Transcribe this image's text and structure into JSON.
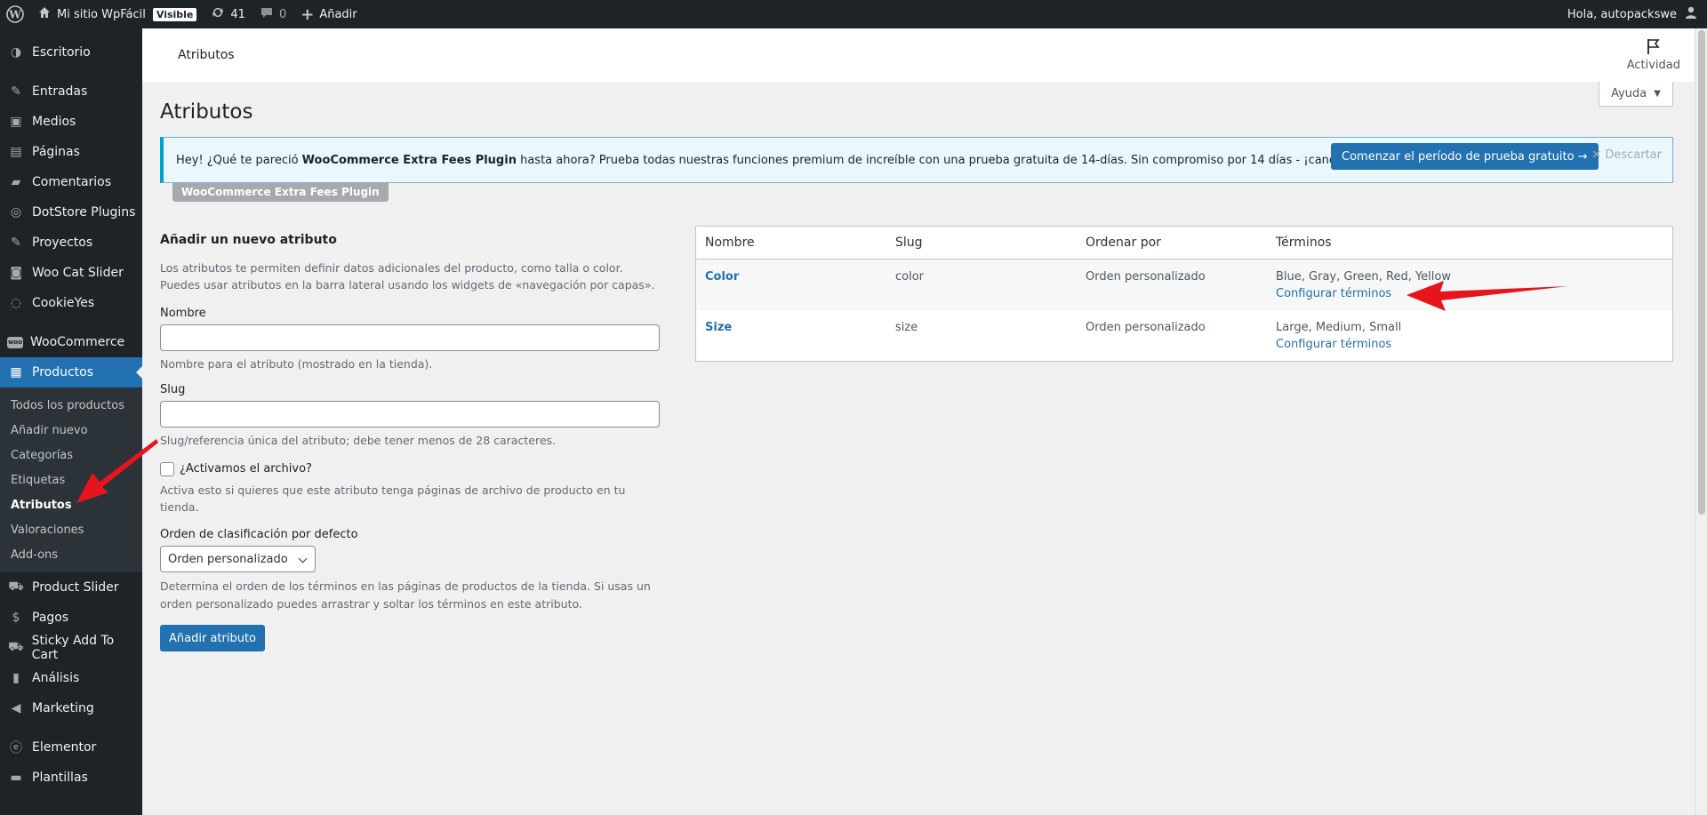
{
  "adminbar": {
    "site_name": "Mi sitio WpFácil",
    "visible_badge": "Visible",
    "updates_count": "41",
    "comments_count": "0",
    "add_new": "Añadir",
    "greeting": "Hola, autopackswe"
  },
  "sidebar": {
    "items": [
      {
        "label": "Escritorio",
        "icon": "dashboard-icon"
      },
      {
        "label": "Entradas",
        "icon": "pin-icon"
      },
      {
        "label": "Medios",
        "icon": "media-icon"
      },
      {
        "label": "Páginas",
        "icon": "page-icon"
      },
      {
        "label": "Comentarios",
        "icon": "comment-icon"
      },
      {
        "label": "DotStore Plugins",
        "icon": "dotstore-icon"
      },
      {
        "label": "Proyectos",
        "icon": "pin-icon"
      },
      {
        "label": "Woo Cat Slider",
        "icon": "camera-icon"
      },
      {
        "label": "CookieYes",
        "icon": "cookie-icon"
      },
      {
        "label": "WooCommerce",
        "icon": "woocommerce-icon"
      },
      {
        "label": "Productos",
        "icon": "archive-icon"
      },
      {
        "label": "Product Slider",
        "icon": "cart-icon"
      },
      {
        "label": "Pagos",
        "icon": "money-icon"
      },
      {
        "label": "Sticky Add To Cart",
        "icon": "cart-icon"
      },
      {
        "label": "Análisis",
        "icon": "chart-icon"
      },
      {
        "label": "Marketing",
        "icon": "megaphone-icon"
      },
      {
        "label": "Elementor",
        "icon": "elementor-icon"
      },
      {
        "label": "Plantillas",
        "icon": "folder-icon"
      }
    ],
    "submenu": [
      "Todos los productos",
      "Añadir nuevo",
      "Categorías",
      "Etiquetas",
      "Atributos",
      "Valoraciones",
      "Add-ons"
    ]
  },
  "topbar": {
    "breadcrumb": "Atributos",
    "activity": "Actividad"
  },
  "help": "Ayuda",
  "page_title": "Atributos",
  "notice": {
    "text_pre": "Hey! ¿Qué te pareció ",
    "plugin_name": "WooCommerce Extra Fees Plugin",
    "text_post": " hasta ahora? Prueba todas nuestras funciones premium de increíble con una prueba gratuita de 14-días. Sin compromiso por 14 días - ¡cancelar en cualquier momento!",
    "cta": "Comenzar el período de prueba gratuito →",
    "dismiss": "Descartar",
    "tag": "WooCommerce Extra Fees Plugin"
  },
  "form": {
    "heading": "Añadir un nuevo atributo",
    "intro": "Los atributos te permiten definir datos adicionales del producto, como talla o color. Puedes usar atributos en la barra lateral usando los widgets de «navegación por capas».",
    "name_label": "Nombre",
    "name_value": "",
    "name_help": "Nombre para el atributo (mostrado en la tienda).",
    "slug_label": "Slug",
    "slug_value": "",
    "slug_help": "Slug/referencia única del atributo; debe tener menos de 28 caracteres.",
    "archive_label": "¿Activamos el archivo?",
    "archive_help": "Activa esto si quieres que este atributo tenga páginas de archivo de producto en tu tienda.",
    "order_label": "Orden de clasificación por defecto",
    "order_value": "Orden personalizado",
    "order_help": "Determina el orden de los términos en las páginas de productos de la tienda. Si usas un orden personalizado puedes arrastrar y soltar los términos en este atributo.",
    "submit": "Añadir atributo"
  },
  "table": {
    "headers": [
      "Nombre",
      "Slug",
      "Ordenar por",
      "Términos"
    ],
    "rows": [
      {
        "name": "Color",
        "slug": "color",
        "order": "Orden personalizado",
        "terms": "Blue, Gray, Green, Red, Yellow",
        "configure": "Configurar términos"
      },
      {
        "name": "Size",
        "slug": "size",
        "order": "Orden personalizado",
        "terms": "Large, Medium, Small",
        "configure": "Configurar términos"
      }
    ]
  },
  "colors": {
    "accent": "#2271b1",
    "sidebar_bg": "#1d2327",
    "arrow": "#e8141c"
  }
}
